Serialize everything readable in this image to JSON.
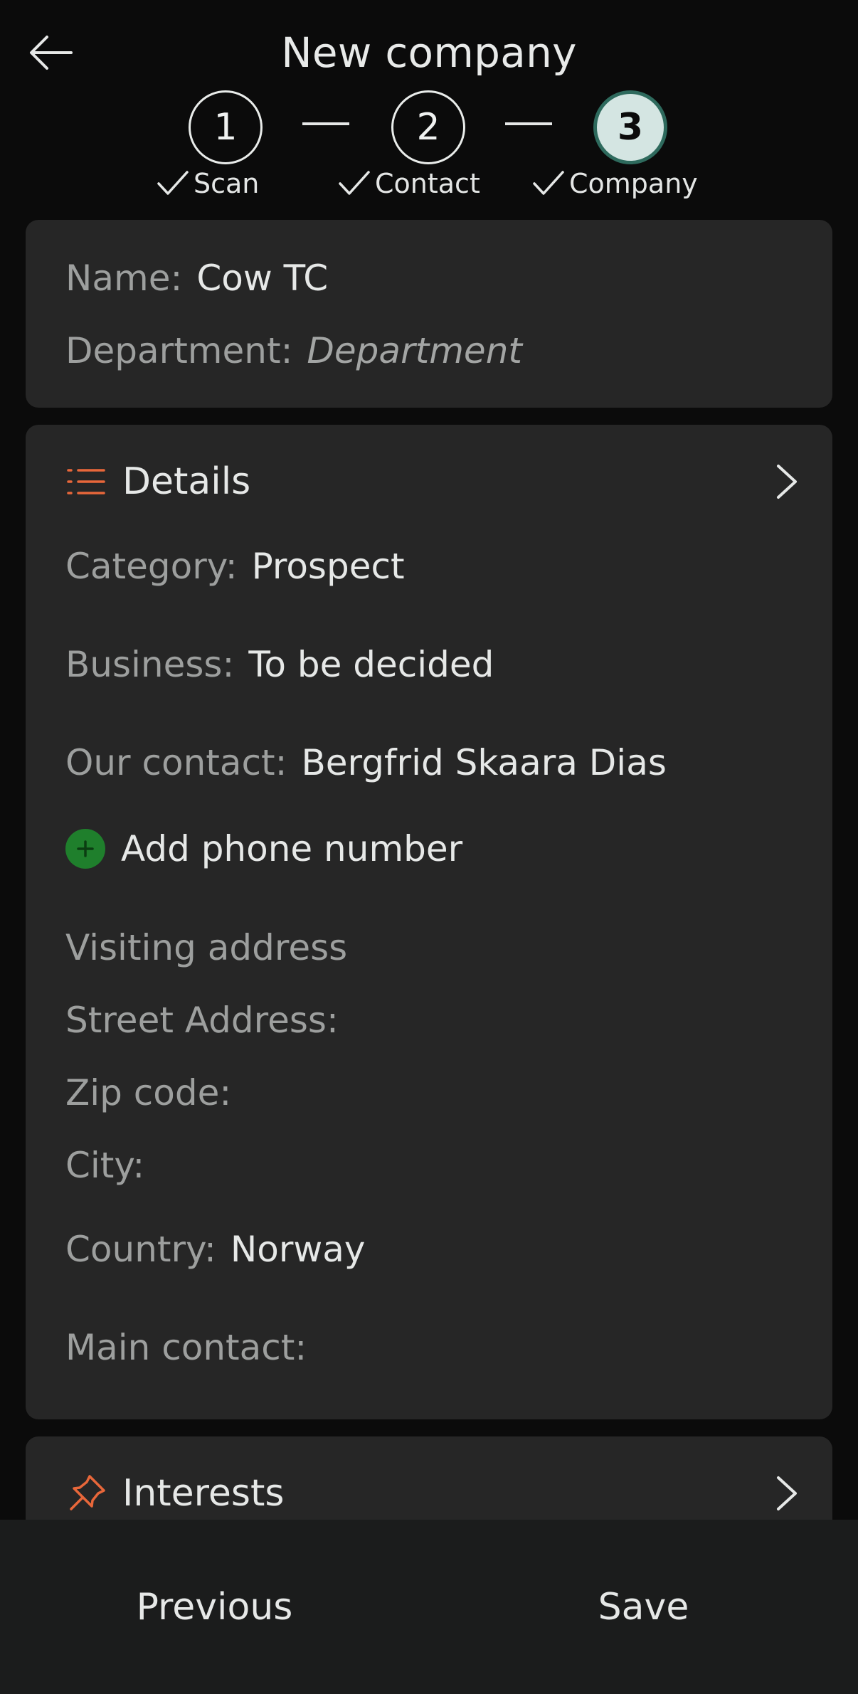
{
  "header": {
    "title": "New company",
    "back_icon": "arrow-left-icon"
  },
  "stepper": {
    "steps": [
      {
        "number": "1",
        "label": "Scan",
        "done": true
      },
      {
        "number": "2",
        "label": "Contact",
        "done": true
      },
      {
        "number": "3",
        "label": "Company",
        "done": true,
        "active": true
      }
    ]
  },
  "company_card": {
    "name_label": "Name:",
    "name_value": "Cow TC",
    "department_label": "Department:",
    "department_placeholder": "Department"
  },
  "details": {
    "title": "Details",
    "category_label": "Category:",
    "category_value": "Prospect",
    "business_label": "Business:",
    "business_value": "To be decided",
    "our_contact_label": "Our contact:",
    "our_contact_value": "Bergfrid Skaara Dias",
    "add_phone_label": "Add phone number",
    "visiting_address_label": "Visiting address",
    "street_label": "Street Address:",
    "zip_label": "Zip code:",
    "city_label": "City:",
    "country_label": "Country:",
    "country_value": "Norway",
    "main_contact_label": "Main contact:"
  },
  "interests": {
    "title": "Interests"
  },
  "bottom_bar": {
    "previous_label": "Previous",
    "save_label": "Save"
  },
  "colors": {
    "accent": "#e8673a",
    "add_green": "#1f7f2c",
    "active_step": "#d4e5e2"
  }
}
